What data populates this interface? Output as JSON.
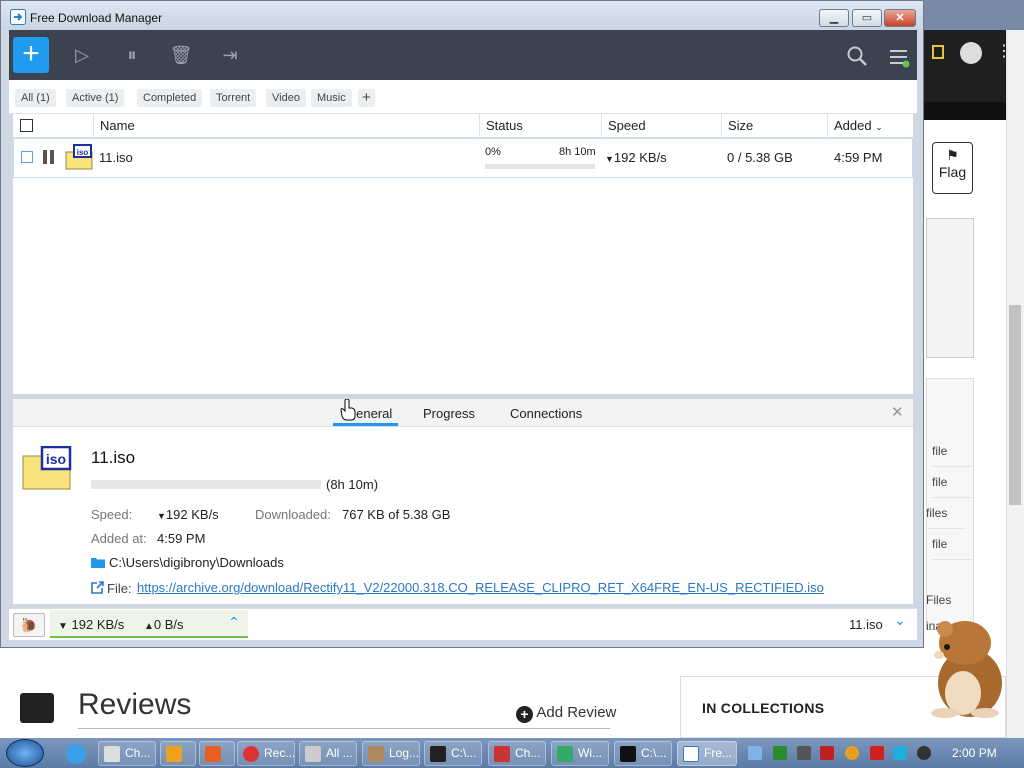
{
  "window": {
    "title": "Free Download Manager",
    "min": "▁",
    "max": "▭",
    "close": "✕"
  },
  "toolbar": {
    "add": "+",
    "icons": [
      "play-icon",
      "pause-all-icon",
      "trash-icon",
      "move-folder-icon"
    ],
    "search": "search-icon",
    "menu": "menu-icon"
  },
  "filters": [
    "All (1)",
    "Active (1)",
    "Completed",
    "Torrent",
    "Video",
    "Music",
    "+"
  ],
  "columns": {
    "name": "Name",
    "status": "Status",
    "speed": "Speed",
    "size": "Size",
    "added": "Added"
  },
  "download": {
    "name": "11.iso",
    "percent": "0%",
    "eta": "8h 10m",
    "speed": "192 KB/s",
    "size": "0 / 5.38 GB",
    "added": "4:59 PM",
    "progress_fraction": 0.0
  },
  "details": {
    "tabs": [
      "General",
      "Progress",
      "Connections"
    ],
    "name": "11.iso",
    "eta": "(8h 10m)",
    "speed_label": "Speed:",
    "speed": "192 KB/s",
    "downloaded_label": "Downloaded:",
    "downloaded": "767 KB of 5.38 GB",
    "added_label": "Added at:",
    "added": "4:59 PM",
    "folder": "C:\\Users\\digibrony\\Downloads",
    "file_label": "File:",
    "file_url": "https://archive.org/download/Rectify11_V2/22000.318.CO_RELEASE_CLIPRO_RET_X64FRE_EN-US_RECTIFIED.iso"
  },
  "statusbar": {
    "down": "192 KB/s",
    "up": "0 B/s",
    "current": "11.iso"
  },
  "background_page": {
    "flag": "Flag",
    "files": [
      "file",
      "file",
      "files",
      "file",
      "Files",
      "inal"
    ],
    "reviews": "Reviews",
    "add_review": "Add Review",
    "collections": "IN COLLECTIONS"
  },
  "taskbar": {
    "tasks": [
      "Ch...",
      "",
      "",
      "Rec...",
      "All ...",
      "Log...",
      "C:\\...",
      "Ch...",
      "Wi...",
      "C:\\...",
      "Fre..."
    ],
    "clock": "2:00 PM"
  },
  "colors": {
    "accent": "#1f9bf0",
    "toolbar": "#3b4350",
    "speed_ok": "#6cc24a",
    "link": "#2b78c6"
  }
}
